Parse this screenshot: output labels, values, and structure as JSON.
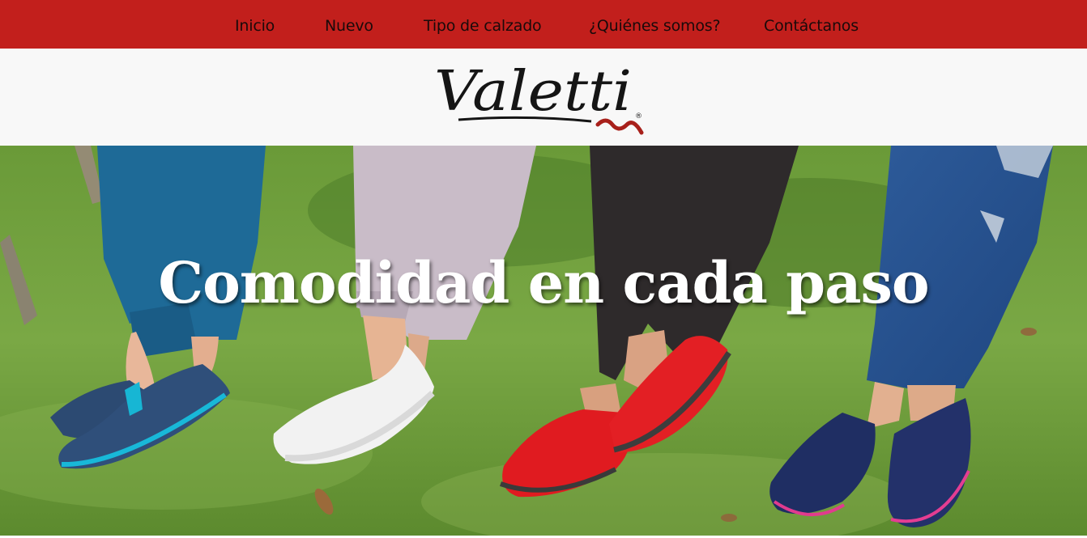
{
  "nav": {
    "items": [
      {
        "label": "Inicio"
      },
      {
        "label": "Nuevo"
      },
      {
        "label": "Tipo de calzado"
      },
      {
        "label": "¿Quiénes somos?"
      },
      {
        "label": "Contáctanos"
      }
    ]
  },
  "brand": {
    "name": "Valetti",
    "registered_mark": "®"
  },
  "hero": {
    "title": "Comodidad en cada paso"
  },
  "colors": {
    "nav_background": "#c21f1c",
    "logo_band_background": "#f8f8f8",
    "nav_text": "#1a0a0a",
    "hero_title": "#ffffff"
  }
}
